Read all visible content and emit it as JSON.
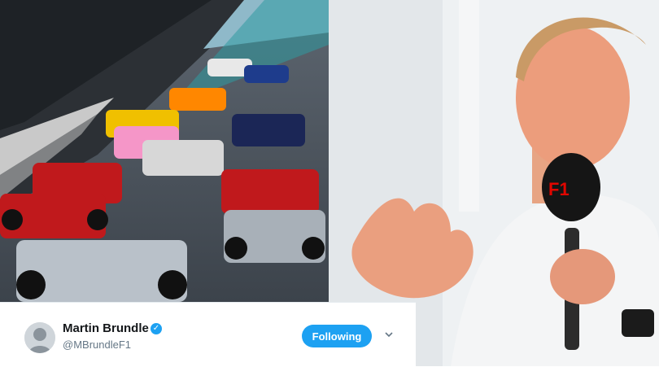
{
  "photos": {
    "left_scene": "f1-race-start",
    "right_scene": "presenter-with-microphone"
  },
  "tweet": {
    "display_name": "Martin Brundle",
    "handle": "@MBrundleF1",
    "follow_label": "Following",
    "verified_icon": "verified-badge-icon",
    "text_partial": ""
  },
  "colors": {
    "twitter_blue": "#1da1f2",
    "text_dark": "#14171a",
    "text_muted": "#657786"
  }
}
